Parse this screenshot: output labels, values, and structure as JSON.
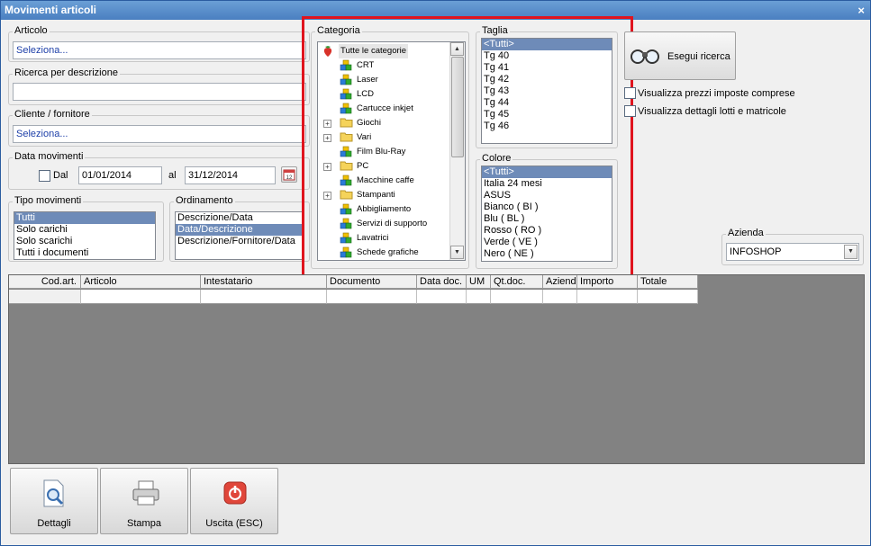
{
  "window": {
    "title": "Movimenti articoli",
    "close_label": "×"
  },
  "articolo": {
    "title": "Articolo",
    "value": "Seleziona..."
  },
  "ricerca": {
    "title": "Ricerca per descrizione",
    "value": ""
  },
  "cliente": {
    "title": "Cliente / fornitore",
    "value": "Seleziona..."
  },
  "data_mov": {
    "title": "Data movimenti",
    "dal_label": "Dal",
    "from": "01/01/2014",
    "al_label": "al",
    "to": "31/12/2014",
    "calendar_label": "12"
  },
  "tipo": {
    "title": "Tipo movimenti",
    "items": [
      "Tutti",
      "Solo carichi",
      "Solo scarichi",
      "Tutti i documenti"
    ],
    "selected": 0
  },
  "ordinamento": {
    "title": "Ordinamento",
    "items": [
      "Descrizione/Data",
      "Data/Descrizione",
      "Descrizione/Fornitore/Data"
    ],
    "selected": 1
  },
  "categoria": {
    "title": "Categoria",
    "items": [
      {
        "label": "Tutte le categorie",
        "icon": "strawberry-icon",
        "root": true
      },
      {
        "label": "CRT",
        "icon": "blocks-icon"
      },
      {
        "label": "Laser",
        "icon": "blocks-icon"
      },
      {
        "label": "LCD",
        "icon": "blocks-icon"
      },
      {
        "label": "Cartucce inkjet",
        "icon": "blocks-icon"
      },
      {
        "label": "Giochi",
        "icon": "folder-icon",
        "expandable": true
      },
      {
        "label": "Vari",
        "icon": "folder-icon",
        "expandable": true
      },
      {
        "label": "Film Blu-Ray",
        "icon": "blocks-icon"
      },
      {
        "label": "PC",
        "icon": "folder-icon",
        "expandable": true
      },
      {
        "label": "Macchine caffe",
        "icon": "blocks-icon"
      },
      {
        "label": "Stampanti",
        "icon": "folder-icon",
        "expandable": true
      },
      {
        "label": "Abbigliamento",
        "icon": "blocks-icon"
      },
      {
        "label": "Servizi di supporto",
        "icon": "blocks-icon"
      },
      {
        "label": "Lavatrici",
        "icon": "blocks-icon"
      },
      {
        "label": "Schede grafiche",
        "icon": "blocks-icon"
      }
    ]
  },
  "taglia": {
    "title": "Taglia",
    "items": [
      "<Tutti>",
      "Tg 40",
      "Tg 41",
      "Tg 42",
      "Tg 43",
      "Tg 44",
      "Tg 45",
      "Tg 46"
    ],
    "selected": 0
  },
  "colore": {
    "title": "Colore",
    "items": [
      "<Tutti>",
      "Italia 24 mesi",
      "ASUS",
      "Bianco ( BI )",
      "Blu ( BL )",
      "Rosso ( RO )",
      "Verde ( VE )",
      "Nero ( NE )"
    ],
    "selected": 0
  },
  "search_button": {
    "label": "Esegui ricerca"
  },
  "options": {
    "prezzi_label": "Visualizza prezzi imposte comprese",
    "lotti_label": "Visualizza dettagli lotti e matricole"
  },
  "azienda": {
    "title": "Azienda",
    "value": "INFOSHOP"
  },
  "grid": {
    "columns": [
      "Cod.art.",
      "Articolo",
      "Intestatario",
      "Documento",
      "Data doc.",
      "UM",
      "Qt.doc.",
      "Azienda",
      "Importo",
      "Totale"
    ]
  },
  "buttons": {
    "dettagli": "Dettagli",
    "stampa": "Stampa",
    "uscita": "Uscita (ESC)"
  },
  "colors": {
    "selection": "#6e8bb8",
    "titlebar": "#4a7fc1",
    "highlight_box": "#e0141e",
    "grid_bg": "#828282"
  }
}
